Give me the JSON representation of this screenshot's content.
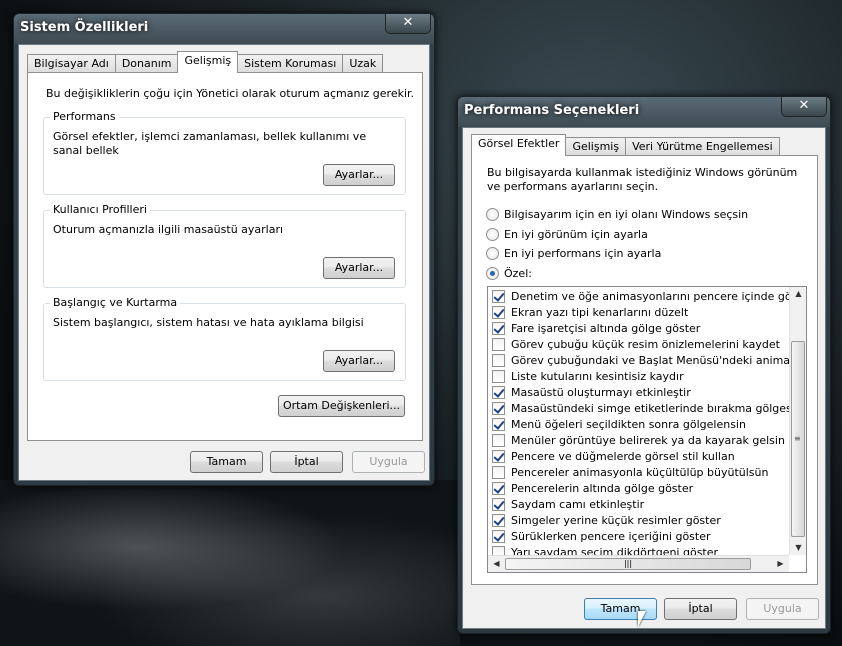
{
  "sysprops": {
    "title": "Sistem Özellikleri",
    "close": "✕",
    "tabs": [
      "Bilgisayar Adı",
      "Donanım",
      "Gelişmiş",
      "Sistem Koruması",
      "Uzak"
    ],
    "admin_note": "Bu değişikliklerin çoğu için Yönetici olarak oturum açmanız gerekir.",
    "performance": {
      "label": "Performans",
      "desc": "Görsel efektler, işlemci zamanlaması, bellek kullanımı ve sanal bellek",
      "button": "Ayarlar..."
    },
    "profiles": {
      "label": "Kullanıcı Profilleri",
      "desc": "Oturum açmanızla ilgili masaüstü ayarları",
      "button": "Ayarlar..."
    },
    "startup": {
      "label": "Başlangıç ve Kurtarma",
      "desc": "Sistem başlangıcı, sistem hatası ve hata ayıklama bilgisi",
      "button": "Ayarlar..."
    },
    "env_button": "Ortam Değişkenleri...",
    "ok": "Tamam",
    "cancel": "İptal",
    "apply": "Uygula"
  },
  "perfopts": {
    "title": "Performans Seçenekleri",
    "close": "✕",
    "tabs": [
      "Görsel Efektler",
      "Gelişmiş",
      "Veri Yürütme Engellemesi"
    ],
    "intro": "Bu bilgisayarda kullanmak istediğiniz Windows görünüm ve performans ayarlarını seçin.",
    "options": [
      {
        "label": "Bilgisayarım için en iyi olanı Windows seçsin",
        "selected": false
      },
      {
        "label": "En iyi görünüm için ayarla",
        "selected": false
      },
      {
        "label": "En iyi performans için ayarla",
        "selected": false
      },
      {
        "label": "Özel:",
        "selected": true
      }
    ],
    "effects": [
      {
        "label": "Denetim ve öğe animasyonlarını pencere içinde göster",
        "checked": true
      },
      {
        "label": "Ekran yazı tipi kenarlarını düzelt",
        "checked": true
      },
      {
        "label": "Fare işaretçisi altında gölge göster",
        "checked": true
      },
      {
        "label": "Görev çubuğu küçük resim önizlemelerini kaydet",
        "checked": false
      },
      {
        "label": "Görev çubuğundaki ve Başlat Menüsü'ndeki animasyon",
        "checked": false
      },
      {
        "label": "Liste kutularını kesintisiz kaydır",
        "checked": false
      },
      {
        "label": "Masaüstü oluşturmayı etkinleştir",
        "checked": true
      },
      {
        "label": "Masaüstündeki simge etiketlerinde bırakma gölgesi ku",
        "checked": true
      },
      {
        "label": "Menü öğeleri seçildikten sonra gölgelensin",
        "checked": true
      },
      {
        "label": "Menüler görüntüye belirerek ya da kayarak gelsin",
        "checked": false
      },
      {
        "label": "Pencere ve düğmelerde görsel stil kullan",
        "checked": true
      },
      {
        "label": "Pencereler animasyonla küçültülüp büyütülsün",
        "checked": false
      },
      {
        "label": "Pencerelerin altında gölge göster",
        "checked": true
      },
      {
        "label": "Saydam camı etkinleştir",
        "checked": true
      },
      {
        "label": "Simgeler yerine küçük resimler göster",
        "checked": true
      },
      {
        "label": "Sürüklerken pencere içeriğini göster",
        "checked": true
      },
      {
        "label": "Yarı saydam seçim dikdörtgeni göster",
        "checked": false
      }
    ],
    "scroll_grip": "|||",
    "ok": "Tamam",
    "cancel": "İptal",
    "apply": "Uygula"
  }
}
